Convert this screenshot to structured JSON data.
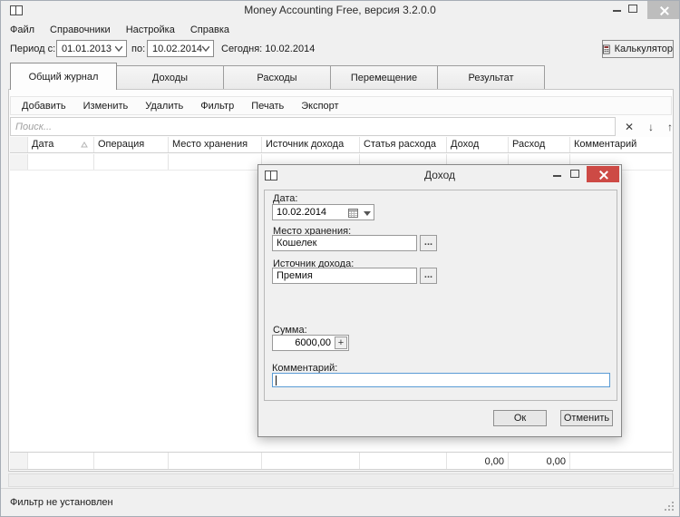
{
  "window": {
    "title": "Money Accounting Free,  версия 3.2.0.0",
    "menu": [
      "Файл",
      "Справочники",
      "Настройка",
      "Справка"
    ],
    "period": {
      "label_from": "Период с:",
      "from_value": "01.01.2013",
      "label_to": "по:",
      "to_value": "10.02.2014",
      "today": "Сегодня: 10.02.2014"
    },
    "calculator_label": "Калькулятор",
    "tabs": [
      "Общий журнал",
      "Доходы",
      "Расходы",
      "Перемещение",
      "Результат"
    ],
    "actions": [
      "Добавить",
      "Изменить",
      "Удалить",
      "Фильтр",
      "Печать",
      "Экспорт"
    ],
    "search_placeholder": "Поиск...",
    "table": {
      "columns": [
        "Дата",
        "Операция",
        "Место хранения",
        "Источник дохода",
        "Статья расхода",
        "Доход",
        "Расход",
        "Комментарий"
      ],
      "totals": {
        "income": "0,00",
        "expense": "0,00"
      }
    },
    "status": "Фильтр не установлен"
  },
  "dialog": {
    "title": "Доход",
    "fields": {
      "date": {
        "label": "Дата:",
        "value": "10.02.2014"
      },
      "storage": {
        "label": "Место хранения:",
        "value": "Кошелек",
        "browse": "..."
      },
      "source": {
        "label": "Источник дохода:",
        "value": "Премия",
        "browse": "..."
      },
      "amount": {
        "label": "Сумма:",
        "value": "6000,00",
        "spin": "+"
      },
      "comment": {
        "label": "Комментарий:",
        "value": ""
      }
    },
    "buttons": {
      "ok": "Ок",
      "cancel": "Отменить"
    }
  },
  "colors": {
    "close_red": "#cd4a45",
    "focus_border": "#5a9bd5",
    "inactive_close": "#bdbdbd"
  }
}
